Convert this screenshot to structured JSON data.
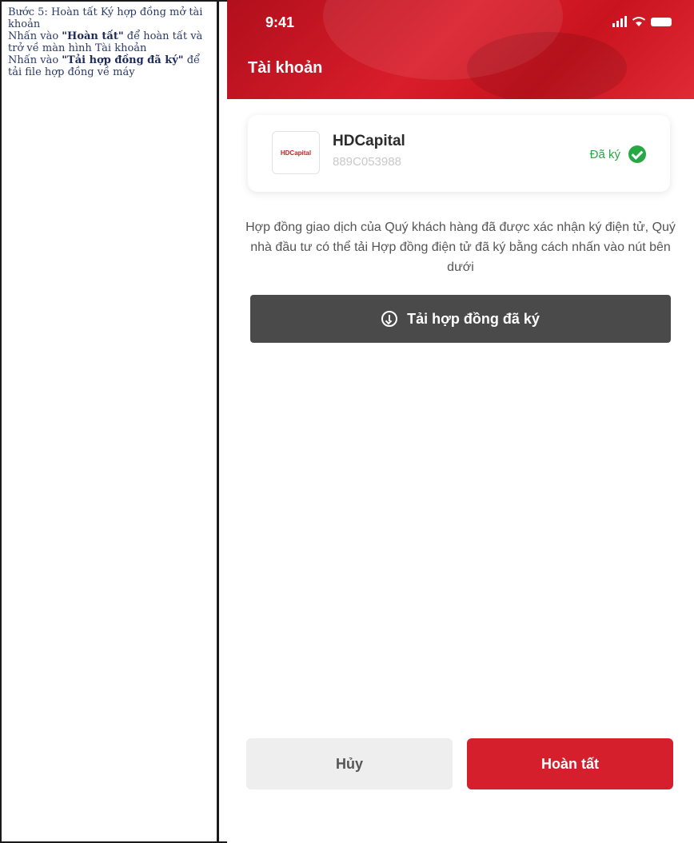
{
  "instructions": {
    "step_title": "Bước 5: Hoàn tất Ký hợp đồng mở tài khoản",
    "line1_pre": "Nhấn vào ",
    "line1_bold": "\"Hoàn tất\"",
    "line1_post": " để hoàn tất và trở về màn hình Tài khoản",
    "line2_pre": "Nhấn vào ",
    "line2_bold": "\"Tải hợp đồng đã ký\"",
    "line2_post": " để tải file hợp đồng về máy"
  },
  "status_bar": {
    "time": "9:41"
  },
  "header": {
    "title": "Tài khoản"
  },
  "account_card": {
    "logo_text": "HDCapital",
    "company_name": "HDCapital",
    "account_id": "889C053988",
    "status": "Đã ký",
    "status_color": "#28a745"
  },
  "description": "Hợp đồng giao dịch của Quý khách hàng đã được xác nhận ký điện tử, Quý nhà đầu tư có thể tải Hợp đồng điện tử đã ký bằng cách nhấn vào nút bên dưới",
  "download_button": {
    "label": "Tải hợp đồng đã ký",
    "icon": "download-circle-icon"
  },
  "footer": {
    "cancel_label": "Hủy",
    "done_label": "Hoàn tất",
    "accent_color": "#d61f2c"
  }
}
